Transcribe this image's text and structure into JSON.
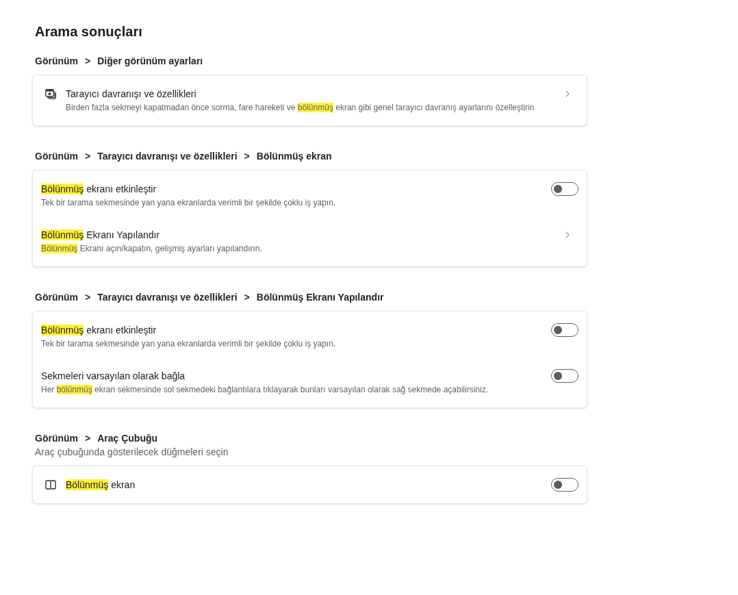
{
  "title": "Arama sonuçları",
  "sections": [
    {
      "breadcrumb": [
        {
          "label": "Görünüm"
        },
        {
          "separator": ">",
          "label": "Diğer görünüm ayarları"
        }
      ],
      "rows": [
        {
          "kind": "feature",
          "title": [
            {
              "text": "Tarayıcı davranışı ve özellikleri",
              "highlighted": false
            }
          ],
          "description": [
            {
              "text": "Birden fazla sekmeyi kapatmadan önce sorma, fare hareketi ve ",
              "highlighted": false
            },
            {
              "text": "bölünmüş",
              "highlighted": true
            },
            {
              "text": " ekran gibi genel tarayıcı davranış ayarlarını özelleştirin",
              "highlighted": false
            }
          ]
        }
      ]
    },
    {
      "breadcrumb": [
        {
          "label": "Görünüm"
        },
        {
          "separator": ">",
          "label": "Tarayıcı davranışı ve özellikleri"
        },
        {
          "separator": ">",
          "label": "Bölünmüş ekran"
        }
      ],
      "rows": [
        {
          "kind": "toggle",
          "on": false,
          "title": [
            {
              "text": "Bölünmüş",
              "highlighted": true
            },
            {
              "text": " ekranı etkinleştir",
              "highlighted": false
            }
          ],
          "description": [
            {
              "text": "Tek bir tarama sekmesinde yan yana ekranlarda verimli bir şekilde çoklu iş yapın.",
              "highlighted": false
            }
          ]
        },
        {
          "kind": "link",
          "title": [
            {
              "text": "Bölünmüş",
              "highlighted": true
            },
            {
              "text": " Ekranı Yapılandır",
              "highlighted": false
            }
          ],
          "description": [
            {
              "text": "Bölünmüş",
              "highlighted": true
            },
            {
              "text": " Ekranı açın/kapatın, gelişmiş ayarları yapılandırın.",
              "highlighted": false
            }
          ]
        }
      ]
    },
    {
      "breadcrumb": [
        {
          "label": "Görünüm"
        },
        {
          "separator": ">",
          "label": "Tarayıcı davranışı ve özellikleri"
        },
        {
          "separator": ">",
          "label": "Bölünmüş Ekranı Yapılandır"
        }
      ],
      "rows": [
        {
          "kind": "toggle",
          "on": false,
          "title": [
            {
              "text": "Bölünmüş",
              "highlighted": true
            },
            {
              "text": " ekranı etkinleştir",
              "highlighted": false
            }
          ],
          "description": [
            {
              "text": "Tek bir tarama sekmesinde yan yana ekranlarda verimli bir şekilde çoklu iş yapın.",
              "highlighted": false
            }
          ]
        },
        {
          "kind": "toggle",
          "on": false,
          "title": [
            {
              "text": "Sekmeleri varsayılan olarak bağla",
              "highlighted": false
            }
          ],
          "description": [
            {
              "text": "Her ",
              "highlighted": false
            },
            {
              "text": "bölünmüş",
              "highlighted": true
            },
            {
              "text": " ekran sekmesinde sol sekmedeki bağlantılara tıklayarak bunları varsayılan olarak sağ sekmede açabilirsiniz.",
              "highlighted": false
            }
          ]
        }
      ]
    },
    {
      "breadcrumb": [
        {
          "label": "Görünüm"
        },
        {
          "separator": ">",
          "label": "Araç Çubuğu"
        }
      ],
      "subtitle": "Araç çubuğunda gösterilecek düğmeleri seçin",
      "rows": [
        {
          "kind": "toolbar-toggle",
          "on": false,
          "title": [
            {
              "text": "Bölünmüş",
              "highlighted": true
            },
            {
              "text": " ekran",
              "highlighted": false
            }
          ]
        }
      ]
    }
  ]
}
